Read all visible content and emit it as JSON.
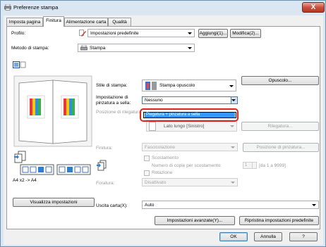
{
  "window": {
    "title": "Preferenze stampa",
    "close_label": "X"
  },
  "tabs": [
    "Imposta pagina",
    "Finitura",
    "Alimentazione carta",
    "Qualità"
  ],
  "profile": {
    "label": "Profilo:",
    "value": "Impostazioni predefinite",
    "add_label": "Aggiungi(1)...",
    "edit_label": "Modifica(2)..."
  },
  "print_method": {
    "label": "Metodo di stampa:",
    "value": "Stampa"
  },
  "preview": {
    "caption": "A4 x2 -> A4",
    "view_settings_label": "Visualizza impostazioni"
  },
  "print_style": {
    "label": "Stile di stampa:",
    "value": "Stampa opuscolo",
    "booklet_button": "Opuscolo..."
  },
  "saddle_stitch": {
    "label_line1": "Impostazione di",
    "label_line2": "pinzatura a sella:",
    "value": "Nessuno",
    "dropdown_option": "Piegatura + pinzatura a sella"
  },
  "binding": {
    "label": "Posizione di rilegatura:",
    "value": "Lato lungo [Sinistro]",
    "button": "Rilegatura..."
  },
  "finishing": {
    "label": "Finitura:",
    "value": "Fascicolazione",
    "staple_position_button": "Posizione di pinzatura..."
  },
  "offset": {
    "label": "Scostamento",
    "copies_label": "Numero di copie per scostamento:",
    "copies_value": "1",
    "range": "[da 1 a 9999]"
  },
  "rotation": {
    "label": "Rotazione"
  },
  "punch": {
    "label": "Foratura:",
    "value": "Disattivato"
  },
  "output": {
    "label": "Uscita carta(X):",
    "value": "Auto"
  },
  "buttons": {
    "advanced": "Impostazioni avanzate(Y)...",
    "restore": "Ripristina impostazioni predefinite",
    "ok": "OK",
    "cancel": "Annulla",
    "help": "?"
  }
}
